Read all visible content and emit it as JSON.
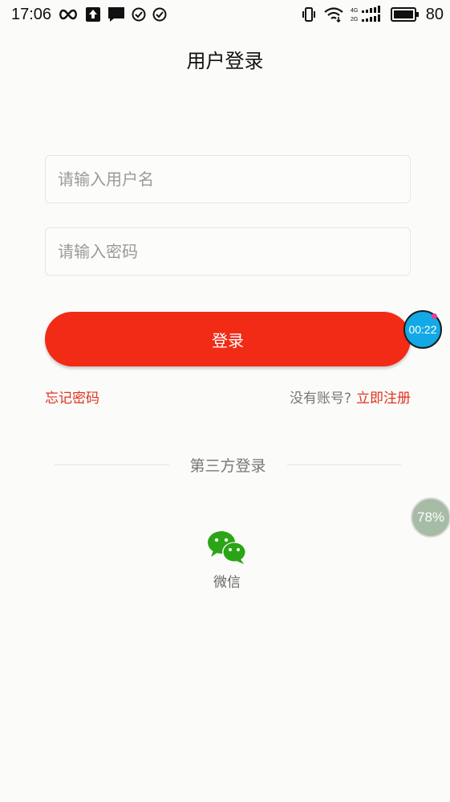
{
  "status_bar": {
    "time": "17:06",
    "battery": "80",
    "icons": [
      "infinity-icon",
      "upload-icon",
      "message-icon",
      "check-circle-icon",
      "check-circle-icon",
      "vibrate-icon",
      "wifi-icon",
      "signal-4g-icon",
      "signal-2g-icon",
      "battery-icon"
    ]
  },
  "header": {
    "title": "用户登录"
  },
  "form": {
    "username_placeholder": "请输入用户名",
    "password_placeholder": "请输入密码",
    "login_label": "登录"
  },
  "links": {
    "forgot": "忘记密码",
    "no_account": "没有账号?",
    "register": "立即注册"
  },
  "third_party": {
    "title": "第三方登录",
    "wechat_label": "微信"
  },
  "overlays": {
    "timer": "00:22",
    "percent": "78%"
  },
  "colors": {
    "accent": "#f22b16",
    "link": "#e0321f",
    "wechat": "#2aa515",
    "timer": "#12a9e6"
  }
}
